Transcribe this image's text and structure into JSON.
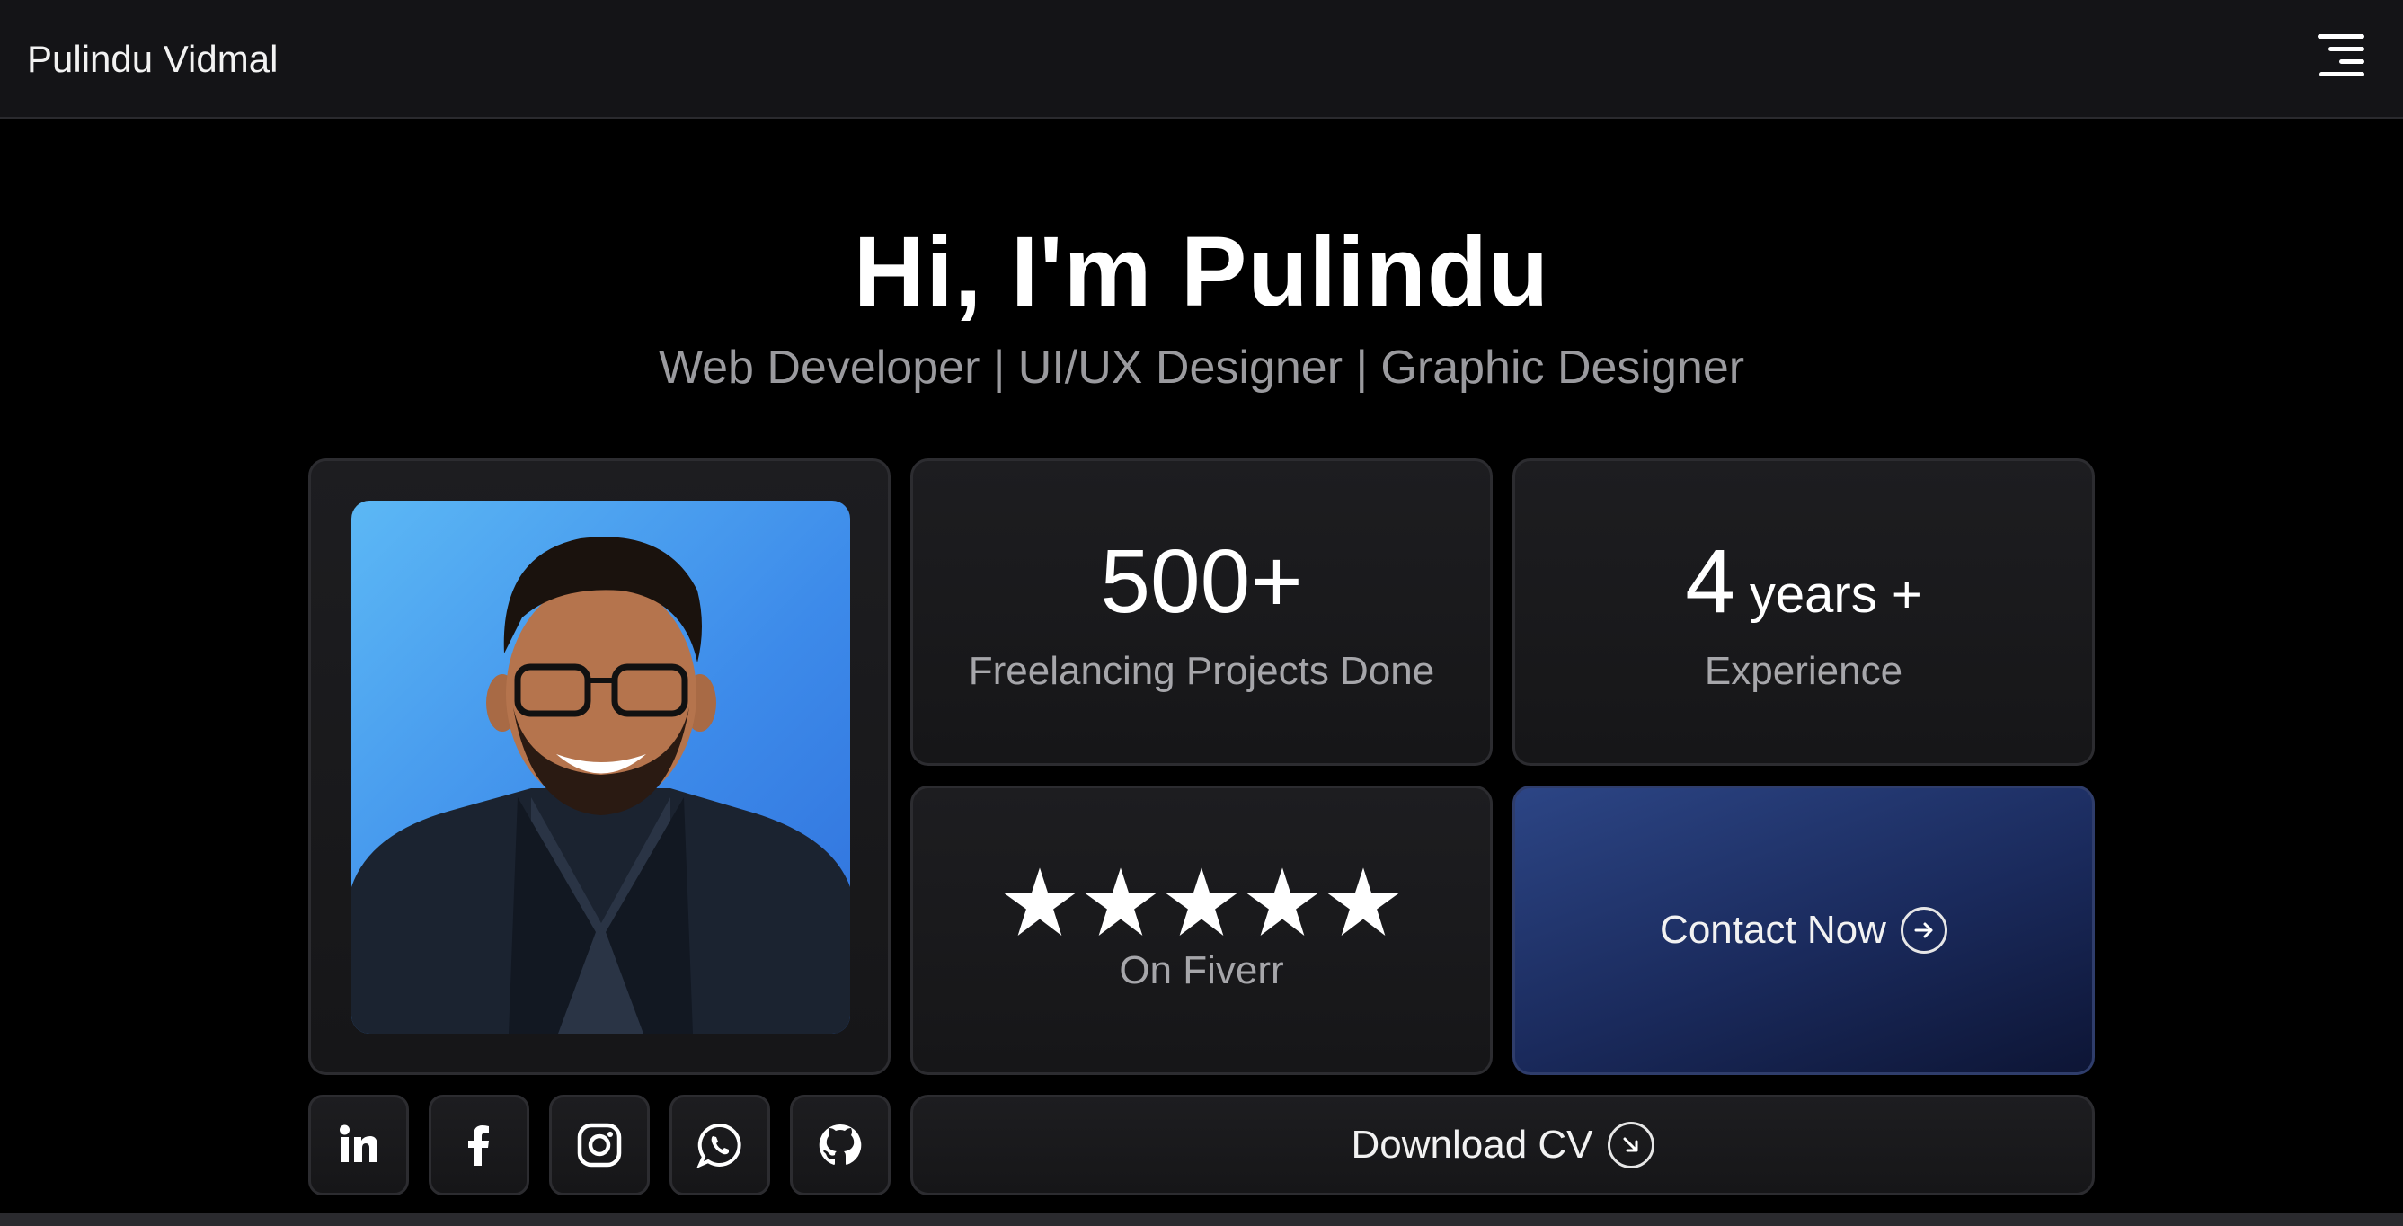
{
  "navbar": {
    "brand": "Pulindu Vidmal",
    "menu_icon": "menu-lines-icon"
  },
  "hero": {
    "title": "Hi, I'm Pulindu",
    "subtitle": "Web Developer | UI/UX Designer | Graphic Designer"
  },
  "stats": {
    "projects_value": "500+",
    "projects_label": "Freelancing Projects Done",
    "years_value": "4",
    "years_unit": "years +",
    "years_label": "Experience",
    "rating_stars": 5,
    "rating_label": "On Fiverr"
  },
  "actions": {
    "contact_label": "Contact Now",
    "contact_icon": "arrow-right-circle-icon",
    "download_label": "Download CV",
    "download_icon": "arrow-down-right-circle-icon"
  },
  "social": [
    "linkedin-icon",
    "facebook-icon",
    "instagram-icon",
    "whatsapp-icon",
    "github-icon"
  ],
  "colors": {
    "background": "#000000",
    "card": "#1a1a1d",
    "accent_blue": "#1f3168",
    "photo_bg": "#3d8bea"
  }
}
